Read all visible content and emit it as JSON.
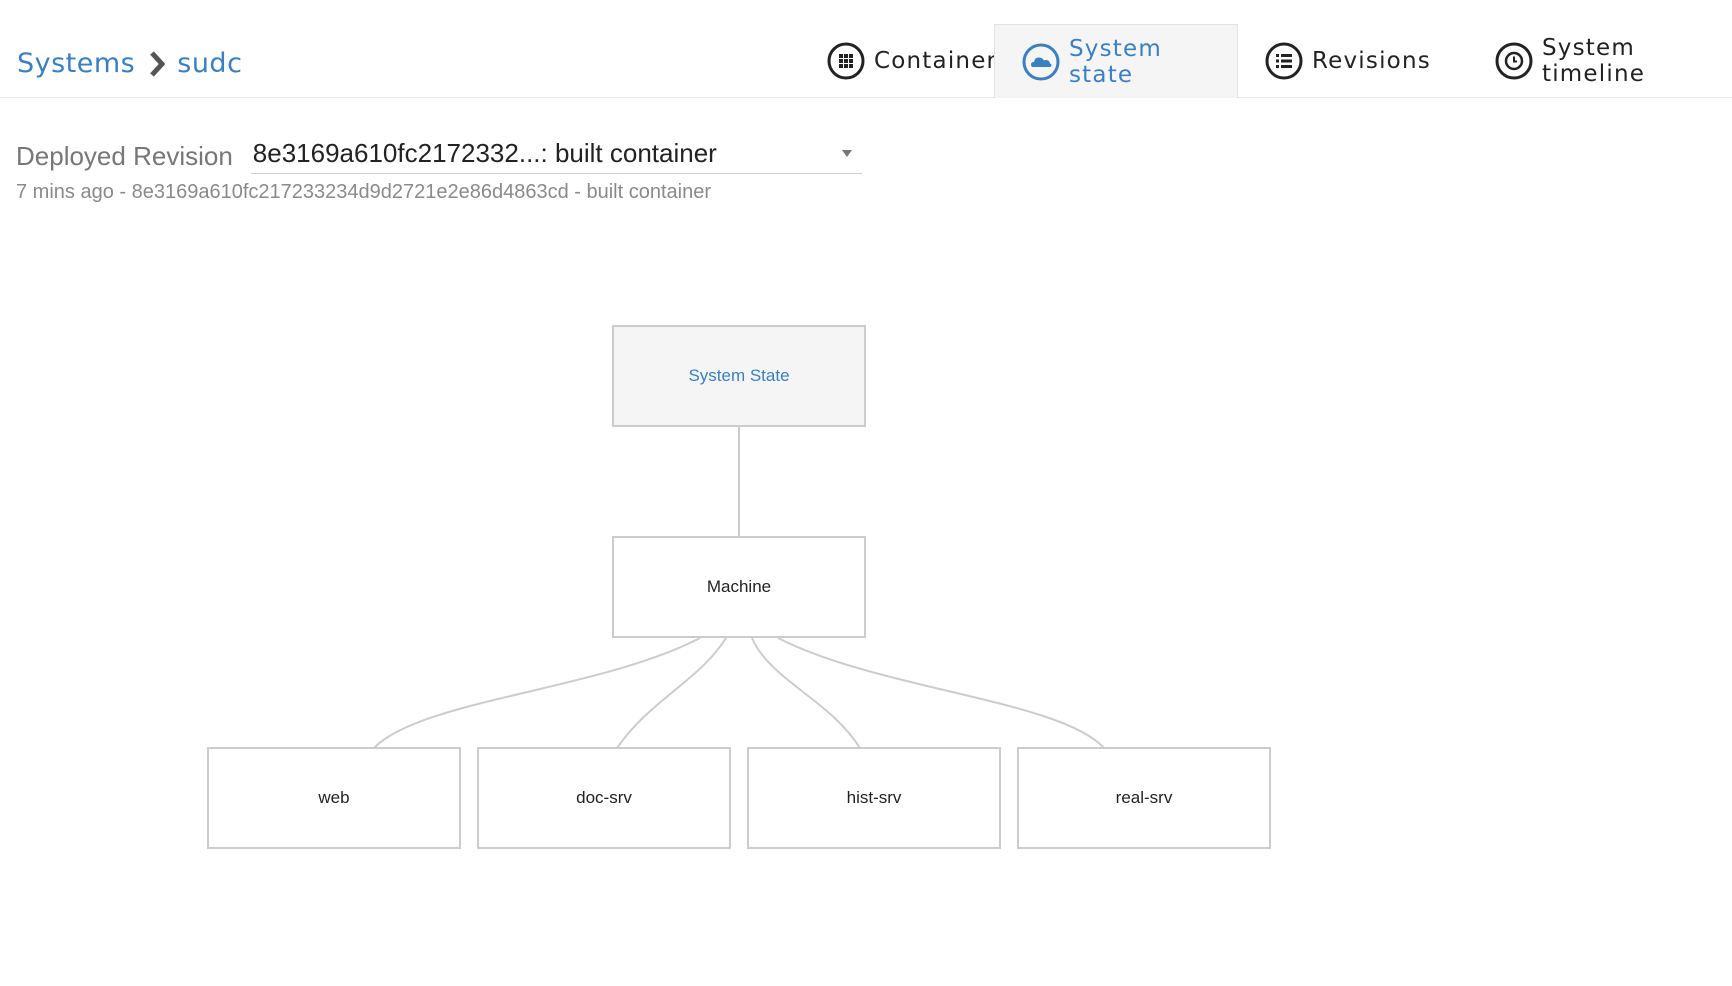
{
  "breadcrumb": {
    "root": "Systems",
    "current": "sudc"
  },
  "tabs": [
    {
      "label": "Containers",
      "icon": "grid-icon",
      "active": false
    },
    {
      "label": "System state",
      "icon": "cloud-icon",
      "active": true
    },
    {
      "label": "Revisions",
      "icon": "list-icon",
      "active": false
    },
    {
      "label": "System timeline",
      "icon": "clock-icon",
      "active": false
    }
  ],
  "revision": {
    "label": "Deployed Revision",
    "selected": "8e3169a610fc2172332...: built container",
    "meta": "7 mins ago - 8e3169a610fc217233234d9d2721e2e86d4863cd - built container"
  },
  "diagram": {
    "root": "System State",
    "machine": "Machine",
    "containers": [
      "web",
      "doc-srv",
      "hist-srv",
      "real-srv"
    ]
  },
  "colors": {
    "accent": "#3a7fc1",
    "node_border": "#cccccc",
    "active_tab_bg": "#f5f5f5"
  }
}
